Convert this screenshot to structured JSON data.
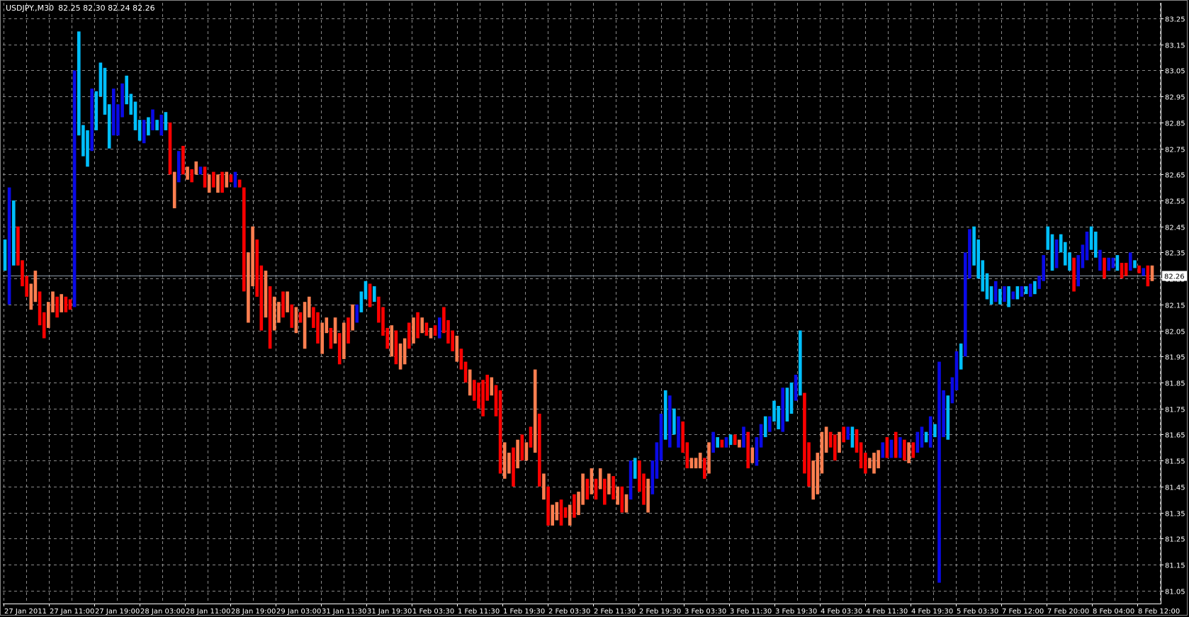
{
  "header": {
    "symbol": "USDJPY.,M30",
    "ohlc": "82.25 82.30 82.24 82.26"
  },
  "current_price": {
    "label": "82.26",
    "value": 82.26
  },
  "colors": {
    "background": "#000000",
    "grid": "#8a8a8a",
    "axis": "#ffffff",
    "text": "#ffffff",
    "price_line": "#8c9aa8"
  },
  "chart_data": {
    "type": "bar",
    "subtype": "heiken-ashi range bars",
    "title": "USDJPY.,M30",
    "ylim": [
      81.0,
      83.31
    ],
    "grid": true,
    "palette": [
      "#0a0ae6",
      "#00bfff",
      "#ff0000",
      "#ff7f50"
    ],
    "palette_meaning": [
      "bull strong",
      "bull",
      "bear strong",
      "bear"
    ],
    "y_ticks": [
      "83.25",
      "83.15",
      "83.05",
      "82.95",
      "82.85",
      "82.75",
      "82.65",
      "82.55",
      "82.45",
      "82.35",
      "82.25",
      "82.15",
      "82.05",
      "81.95",
      "81.85",
      "81.75",
      "81.65",
      "81.55",
      "81.45",
      "81.35",
      "81.25",
      "81.15",
      "81.05"
    ],
    "x_ticks": [
      "27 Jan 2011",
      "27 Jan 11:00",
      "27 Jan 19:00",
      "28 Jan 03:00",
      "28 Jan 11:00",
      "28 Jan 19:00",
      "29 Jan 03:00",
      "31 Jan 11:30",
      "31 Jan 19:30",
      "1 Feb 03:30",
      "1 Feb 11:30",
      "1 Feb 19:30",
      "2 Feb 03:30",
      "2 Feb 11:30",
      "2 Feb 19:30",
      "3 Feb 03:30",
      "3 Feb 11:30",
      "3 Feb 19:30",
      "4 Feb 03:30",
      "4 Feb 11:30",
      "4 Feb 19:30",
      "5 Feb 03:30",
      "7 Feb 12:00",
      "7 Feb 20:00",
      "8 Feb 04:00",
      "8 Feb 12:00"
    ],
    "bars": [
      [
        82.28,
        82.4,
        1
      ],
      [
        82.15,
        82.6,
        0
      ],
      [
        82.3,
        82.55,
        1
      ],
      [
        82.3,
        82.45,
        2
      ],
      [
        82.22,
        82.32,
        2
      ],
      [
        82.18,
        82.26,
        2
      ],
      [
        82.13,
        82.23,
        3
      ],
      [
        82.16,
        82.28,
        3
      ],
      [
        82.07,
        82.2,
        2
      ],
      [
        82.02,
        82.12,
        2
      ],
      [
        82.06,
        82.16,
        3
      ],
      [
        82.12,
        82.2,
        3
      ],
      [
        82.1,
        82.18,
        2
      ],
      [
        82.12,
        82.19,
        3
      ],
      [
        82.12,
        82.18,
        2
      ],
      [
        82.13,
        82.17,
        2
      ],
      [
        82.14,
        83.05,
        0
      ],
      [
        82.8,
        83.2,
        1
      ],
      [
        82.72,
        82.84,
        1
      ],
      [
        82.68,
        82.82,
        1
      ],
      [
        82.74,
        82.98,
        0
      ],
      [
        82.82,
        82.97,
        1
      ],
      [
        82.95,
        83.08,
        1
      ],
      [
        82.88,
        83.06,
        1
      ],
      [
        82.75,
        82.92,
        1
      ],
      [
        82.8,
        82.98,
        0
      ],
      [
        82.8,
        82.92,
        0
      ],
      [
        82.87,
        83.0,
        0
      ],
      [
        82.92,
        83.03,
        1
      ],
      [
        82.88,
        82.96,
        1
      ],
      [
        82.82,
        82.93,
        1
      ],
      [
        82.78,
        82.86,
        1
      ],
      [
        82.77,
        82.86,
        0
      ],
      [
        82.8,
        82.87,
        1
      ],
      [
        82.82,
        82.9,
        0
      ],
      [
        82.82,
        82.86,
        1
      ],
      [
        82.8,
        82.88,
        0
      ],
      [
        82.82,
        82.89,
        1
      ],
      [
        82.65,
        82.85,
        2
      ],
      [
        82.52,
        82.66,
        3
      ],
      [
        82.62,
        82.74,
        0
      ],
      [
        82.65,
        82.76,
        2
      ],
      [
        82.63,
        82.68,
        3
      ],
      [
        82.62,
        82.67,
        2
      ],
      [
        82.65,
        82.7,
        3
      ],
      [
        82.65,
        82.68,
        0
      ],
      [
        82.6,
        82.68,
        2
      ],
      [
        82.58,
        82.65,
        3
      ],
      [
        82.6,
        82.66,
        2
      ],
      [
        82.58,
        82.65,
        3
      ],
      [
        82.58,
        82.66,
        2
      ],
      [
        82.6,
        82.66,
        3
      ],
      [
        82.62,
        82.65,
        2
      ],
      [
        82.6,
        82.66,
        0
      ],
      [
        82.6,
        82.63,
        2
      ],
      [
        82.2,
        82.6,
        2
      ],
      [
        82.08,
        82.35,
        3
      ],
      [
        82.22,
        82.45,
        3
      ],
      [
        82.18,
        82.4,
        2
      ],
      [
        82.05,
        82.3,
        2
      ],
      [
        82.1,
        82.28,
        3
      ],
      [
        81.98,
        82.22,
        2
      ],
      [
        82.05,
        82.18,
        3
      ],
      [
        82.08,
        82.16,
        3
      ],
      [
        82.1,
        82.2,
        2
      ],
      [
        82.12,
        82.2,
        3
      ],
      [
        82.06,
        82.15,
        2
      ],
      [
        82.04,
        82.14,
        3
      ],
      [
        82.08,
        82.12,
        2
      ],
      [
        81.98,
        82.16,
        3
      ],
      [
        82.1,
        82.18,
        3
      ],
      [
        82.06,
        82.14,
        2
      ],
      [
        82.0,
        82.12,
        2
      ],
      [
        81.96,
        82.08,
        3
      ],
      [
        82.04,
        82.1,
        3
      ],
      [
        81.98,
        82.06,
        2
      ],
      [
        82.0,
        82.1,
        3
      ],
      [
        81.92,
        82.04,
        2
      ],
      [
        81.94,
        82.08,
        3
      ],
      [
        82.0,
        82.1,
        2
      ],
      [
        82.05,
        82.15,
        3
      ],
      [
        82.08,
        82.15,
        0
      ],
      [
        82.12,
        82.2,
        1
      ],
      [
        82.17,
        82.24,
        1
      ],
      [
        82.14,
        82.23,
        2
      ],
      [
        82.16,
        82.22,
        1
      ],
      [
        82.08,
        82.18,
        2
      ],
      [
        82.03,
        82.14,
        2
      ],
      [
        81.98,
        82.06,
        2
      ],
      [
        81.95,
        82.07,
        3
      ],
      [
        81.92,
        82.05,
        2
      ],
      [
        81.9,
        82.0,
        3
      ],
      [
        81.92,
        82.02,
        3
      ],
      [
        81.98,
        82.08,
        2
      ],
      [
        82.0,
        82.1,
        3
      ],
      [
        82.02,
        82.12,
        2
      ],
      [
        82.04,
        82.1,
        3
      ],
      [
        82.03,
        82.08,
        2
      ],
      [
        82.02,
        82.06,
        3
      ],
      [
        82.03,
        82.07,
        2
      ],
      [
        82.02,
        82.1,
        0
      ],
      [
        82.04,
        82.14,
        2
      ],
      [
        82.0,
        82.09,
        2
      ],
      [
        81.97,
        82.05,
        2
      ],
      [
        81.93,
        82.03,
        3
      ],
      [
        81.9,
        81.98,
        2
      ],
      [
        81.85,
        81.93,
        2
      ],
      [
        81.8,
        81.9,
        3
      ],
      [
        81.78,
        81.86,
        2
      ],
      [
        81.75,
        81.85,
        2
      ],
      [
        81.72,
        81.86,
        2
      ],
      [
        81.78,
        81.88,
        2
      ],
      [
        81.8,
        81.87,
        3
      ],
      [
        81.72,
        81.84,
        2
      ],
      [
        81.5,
        81.82,
        2
      ],
      [
        81.48,
        81.62,
        3
      ],
      [
        81.5,
        81.58,
        3
      ],
      [
        81.45,
        81.6,
        2
      ],
      [
        81.52,
        81.63,
        3
      ],
      [
        81.55,
        81.65,
        2
      ],
      [
        81.55,
        81.62,
        3
      ],
      [
        81.6,
        81.68,
        2
      ],
      [
        81.58,
        81.9,
        3
      ],
      [
        81.45,
        81.73,
        2
      ],
      [
        81.4,
        81.5,
        3
      ],
      [
        81.3,
        81.45,
        2
      ],
      [
        81.3,
        81.38,
        3
      ],
      [
        81.32,
        81.39,
        3
      ],
      [
        81.3,
        81.4,
        2
      ],
      [
        81.33,
        81.37,
        2
      ],
      [
        81.3,
        81.38,
        3
      ],
      [
        81.33,
        81.42,
        2
      ],
      [
        81.34,
        81.43,
        3
      ],
      [
        81.38,
        81.5,
        3
      ],
      [
        81.4,
        81.48,
        2
      ],
      [
        81.42,
        81.52,
        3
      ],
      [
        81.4,
        81.48,
        2
      ],
      [
        81.44,
        81.52,
        3
      ],
      [
        81.38,
        81.48,
        2
      ],
      [
        81.42,
        81.5,
        3
      ],
      [
        81.4,
        81.49,
        2
      ],
      [
        81.38,
        81.45,
        3
      ],
      [
        81.35,
        81.45,
        2
      ],
      [
        81.35,
        81.42,
        3
      ],
      [
        81.4,
        81.55,
        0
      ],
      [
        81.48,
        81.56,
        1
      ],
      [
        81.43,
        81.55,
        2
      ],
      [
        81.38,
        81.5,
        2
      ],
      [
        81.35,
        81.48,
        3
      ],
      [
        81.42,
        81.55,
        0
      ],
      [
        81.48,
        81.62,
        0
      ],
      [
        81.55,
        81.73,
        0
      ],
      [
        81.63,
        81.82,
        1
      ],
      [
        81.6,
        81.8,
        0
      ],
      [
        81.65,
        81.75,
        1
      ],
      [
        81.6,
        81.72,
        0
      ],
      [
        81.58,
        81.7,
        2
      ],
      [
        81.52,
        81.62,
        2
      ],
      [
        81.52,
        81.56,
        3
      ],
      [
        81.52,
        81.56,
        3
      ],
      [
        81.52,
        81.58,
        3
      ],
      [
        81.48,
        81.56,
        2
      ],
      [
        81.5,
        81.62,
        3
      ],
      [
        81.58,
        81.66,
        0
      ],
      [
        81.6,
        81.64,
        1
      ],
      [
        81.6,
        81.63,
        2
      ],
      [
        81.6,
        81.64,
        0
      ],
      [
        81.61,
        81.65,
        1
      ],
      [
        81.61,
        81.65,
        2
      ],
      [
        81.6,
        81.63,
        3
      ],
      [
        81.6,
        81.68,
        0
      ],
      [
        81.52,
        81.66,
        2
      ],
      [
        81.54,
        81.6,
        3
      ],
      [
        81.53,
        81.64,
        0
      ],
      [
        81.6,
        81.69,
        0
      ],
      [
        81.64,
        81.72,
        1
      ],
      [
        81.66,
        81.72,
        0
      ],
      [
        81.7,
        81.78,
        1
      ],
      [
        81.67,
        81.76,
        1
      ],
      [
        81.66,
        81.83,
        0
      ],
      [
        81.7,
        81.83,
        1
      ],
      [
        81.73,
        81.85,
        1
      ],
      [
        81.78,
        81.88,
        0
      ],
      [
        81.8,
        82.05,
        1
      ],
      [
        81.5,
        81.81,
        2
      ],
      [
        81.45,
        81.62,
        2
      ],
      [
        81.4,
        81.55,
        3
      ],
      [
        81.42,
        81.58,
        3
      ],
      [
        81.5,
        81.66,
        3
      ],
      [
        81.58,
        81.68,
        3
      ],
      [
        81.6,
        81.66,
        2
      ],
      [
        81.55,
        81.65,
        2
      ],
      [
        81.58,
        81.66,
        3
      ],
      [
        81.62,
        81.68,
        2
      ],
      [
        81.63,
        81.68,
        0
      ],
      [
        81.6,
        81.68,
        1
      ],
      [
        81.58,
        81.67,
        2
      ],
      [
        81.52,
        81.62,
        2
      ],
      [
        81.5,
        81.58,
        2
      ],
      [
        81.52,
        81.56,
        3
      ],
      [
        81.5,
        81.58,
        3
      ],
      [
        81.52,
        81.59,
        3
      ],
      [
        81.56,
        81.62,
        0
      ],
      [
        81.56,
        81.64,
        2
      ],
      [
        81.56,
        81.63,
        0
      ],
      [
        81.56,
        81.66,
        2
      ],
      [
        81.56,
        81.64,
        0
      ],
      [
        81.55,
        81.63,
        2
      ],
      [
        81.54,
        81.62,
        3
      ],
      [
        81.56,
        81.62,
        2
      ],
      [
        81.58,
        81.66,
        0
      ],
      [
        81.6,
        81.68,
        0
      ],
      [
        81.62,
        81.66,
        1
      ],
      [
        81.6,
        81.72,
        0
      ],
      [
        81.64,
        81.69,
        1
      ],
      [
        81.08,
        81.93,
        0
      ],
      [
        81.64,
        81.82,
        0
      ],
      [
        81.63,
        81.8,
        1
      ],
      [
        81.77,
        81.87,
        0
      ],
      [
        81.82,
        81.97,
        0
      ],
      [
        81.9,
        82.0,
        1
      ],
      [
        81.95,
        82.35,
        0
      ],
      [
        82.25,
        82.44,
        0
      ],
      [
        82.3,
        82.45,
        1
      ],
      [
        82.25,
        82.4,
        1
      ],
      [
        82.2,
        82.32,
        1
      ],
      [
        82.17,
        82.27,
        1
      ],
      [
        82.15,
        82.22,
        1
      ],
      [
        82.16,
        82.24,
        0
      ],
      [
        82.15,
        82.21,
        1
      ],
      [
        82.16,
        82.22,
        0
      ],
      [
        82.14,
        82.22,
        1
      ],
      [
        82.17,
        82.2,
        0
      ],
      [
        82.17,
        82.22,
        1
      ],
      [
        82.18,
        82.22,
        0
      ],
      [
        82.19,
        82.22,
        1
      ],
      [
        82.18,
        82.23,
        0
      ],
      [
        82.19,
        82.24,
        1
      ],
      [
        82.21,
        82.26,
        0
      ],
      [
        82.24,
        82.34,
        0
      ],
      [
        82.36,
        82.45,
        1
      ],
      [
        82.28,
        82.42,
        1
      ],
      [
        82.29,
        82.4,
        0
      ],
      [
        82.35,
        82.42,
        1
      ],
      [
        82.3,
        82.39,
        1
      ],
      [
        82.28,
        82.35,
        1
      ],
      [
        82.2,
        82.33,
        2
      ],
      [
        82.22,
        82.34,
        0
      ],
      [
        82.29,
        82.38,
        0
      ],
      [
        82.32,
        82.43,
        0
      ],
      [
        82.36,
        82.45,
        1
      ],
      [
        82.33,
        82.43,
        1
      ],
      [
        82.28,
        82.36,
        0
      ],
      [
        82.25,
        82.33,
        2
      ],
      [
        82.28,
        82.33,
        0
      ],
      [
        82.29,
        82.33,
        0
      ],
      [
        82.28,
        82.34,
        1
      ],
      [
        82.25,
        82.31,
        2
      ],
      [
        82.26,
        82.31,
        2
      ],
      [
        82.28,
        82.35,
        0
      ],
      [
        82.29,
        82.32,
        1
      ],
      [
        82.27,
        82.3,
        2
      ],
      [
        82.26,
        82.29,
        0
      ],
      [
        82.22,
        82.3,
        2
      ],
      [
        82.24,
        82.3,
        3
      ]
    ]
  }
}
